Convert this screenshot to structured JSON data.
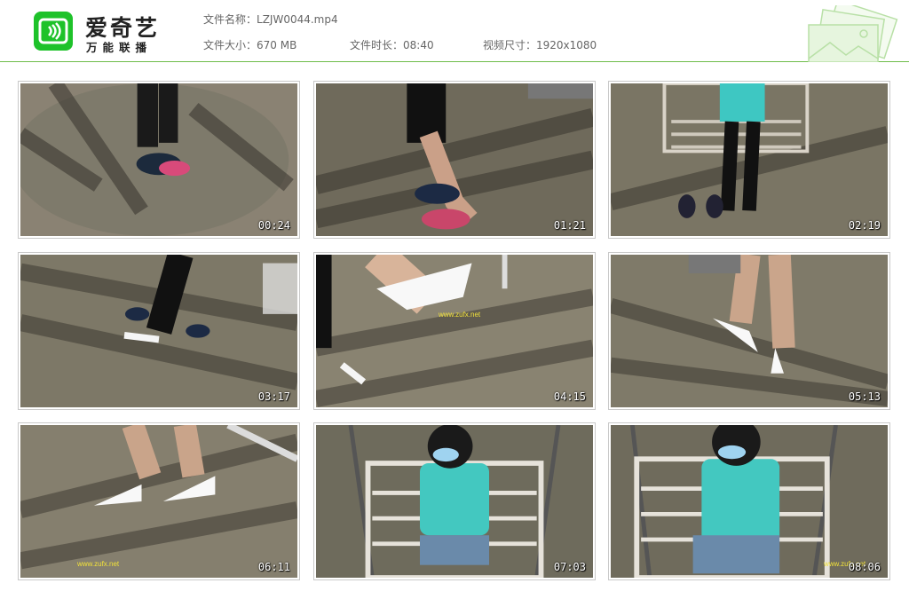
{
  "logo": {
    "main": "爱奇艺",
    "sub": "万能联播"
  },
  "file_info": {
    "name_label": "文件名称：",
    "name_value": "LZJW0044.mp4",
    "size_label": "文件大小：",
    "size_value": "670 MB",
    "duration_label": "文件时长：",
    "duration_value": "08:40",
    "dimensions_label": "视频尺寸：",
    "dimensions_value": "1920x1080"
  },
  "colors": {
    "brand_green": "#1ec22a",
    "divider": "#6fbd4a"
  },
  "thumbnails": [
    {
      "time": "00:24",
      "watermark": ""
    },
    {
      "time": "01:21",
      "watermark": ""
    },
    {
      "time": "02:19",
      "watermark": ""
    },
    {
      "time": "03:17",
      "watermark": ""
    },
    {
      "time": "04:15",
      "watermark": "www.zufx.net"
    },
    {
      "time": "05:13",
      "watermark": ""
    },
    {
      "time": "06:11",
      "watermark": "www.zufx.net"
    },
    {
      "time": "07:03",
      "watermark": ""
    },
    {
      "time": "08:06",
      "watermark": "www.zufx.net"
    }
  ]
}
